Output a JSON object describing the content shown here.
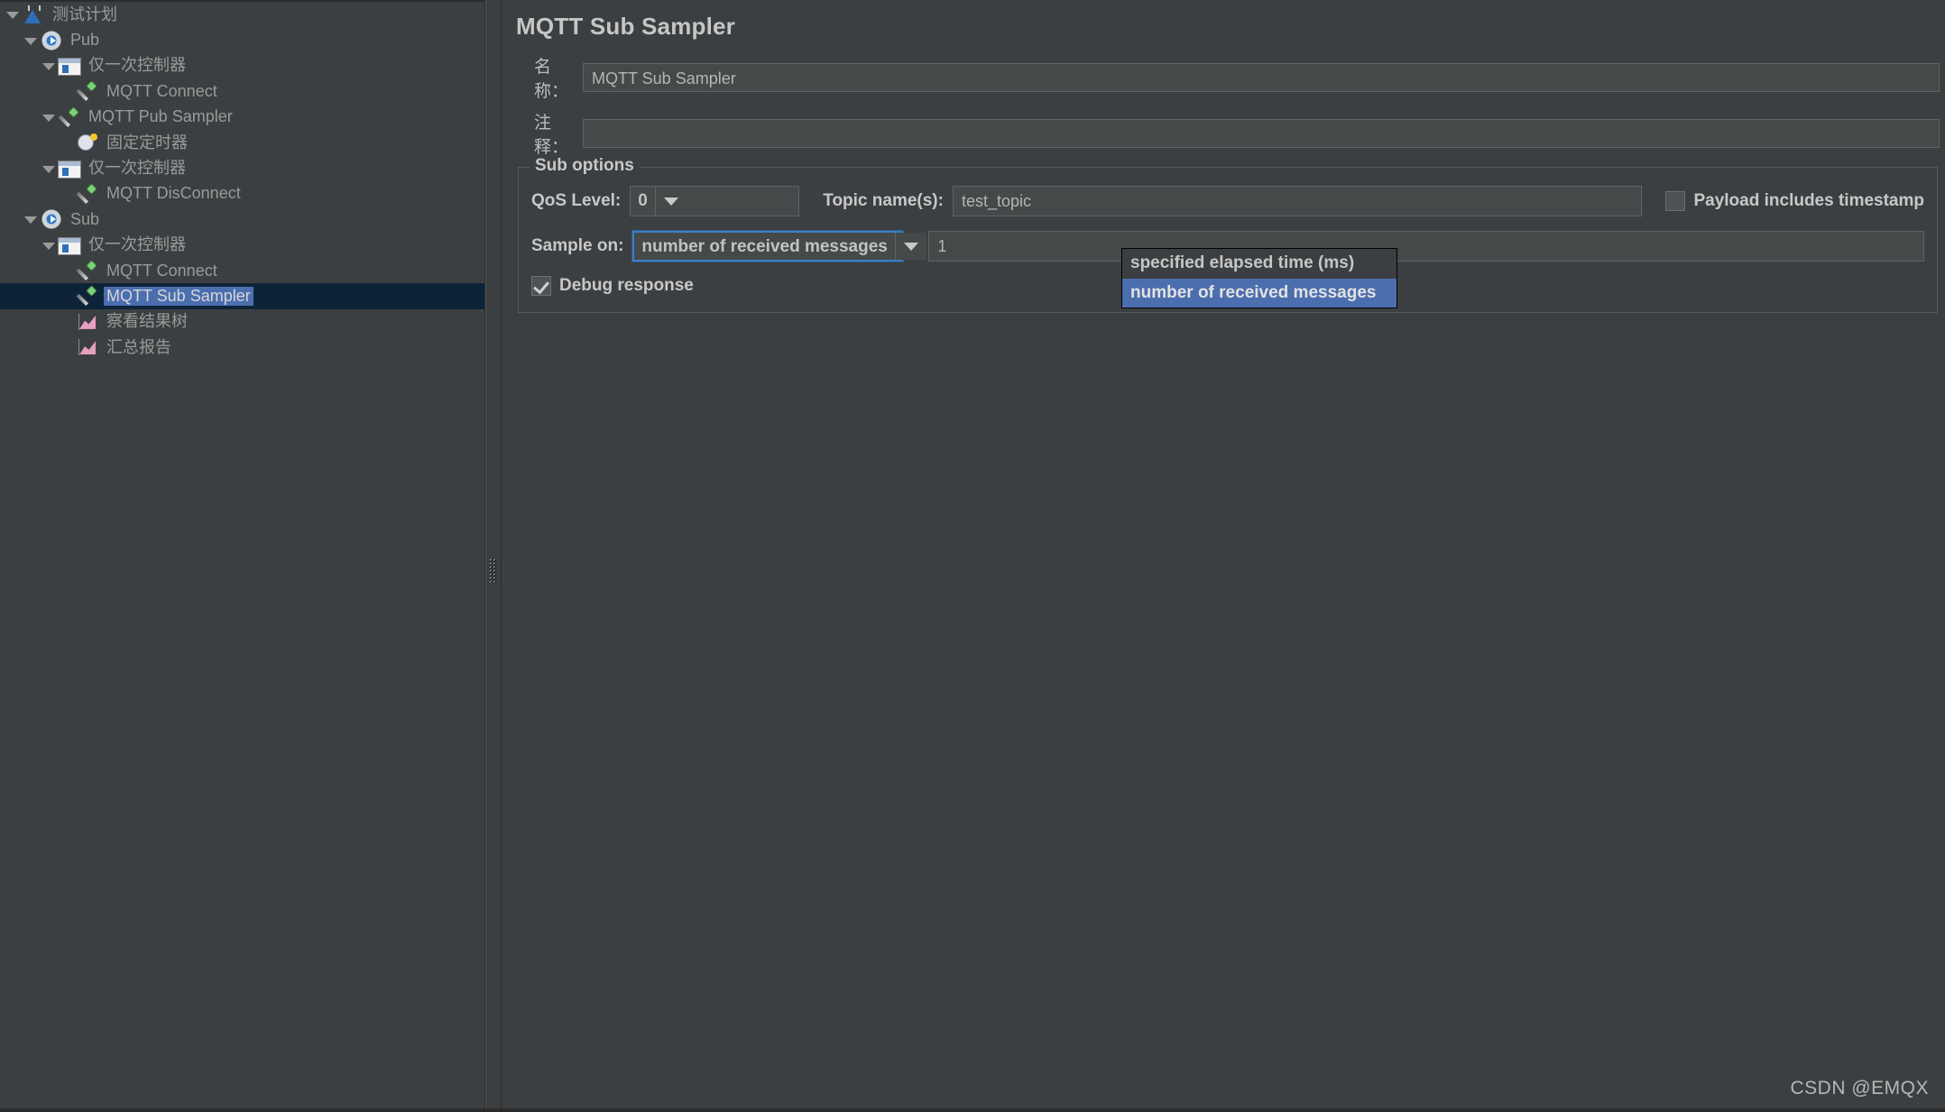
{
  "tree": {
    "items": [
      {
        "label": "测试计划",
        "icon": "flask-icon",
        "indent": 0,
        "twisty": "open",
        "selected": false
      },
      {
        "label": "Pub",
        "icon": "thread-group-gear-icon",
        "indent": 1,
        "twisty": "open",
        "selected": false
      },
      {
        "label": "仅一次控制器",
        "icon": "controller-icon",
        "indent": 2,
        "twisty": "open",
        "selected": false
      },
      {
        "label": "MQTT Connect",
        "icon": "sampler-icon",
        "indent": 3,
        "twisty": "none",
        "selected": false
      },
      {
        "label": "MQTT Pub Sampler",
        "icon": "sampler-icon",
        "indent": 2,
        "twisty": "open",
        "selected": false
      },
      {
        "label": "固定定时器",
        "icon": "timer-icon",
        "indent": 3,
        "twisty": "none",
        "selected": false
      },
      {
        "label": "仅一次控制器",
        "icon": "controller-icon",
        "indent": 2,
        "twisty": "open",
        "selected": false
      },
      {
        "label": "MQTT DisConnect",
        "icon": "sampler-icon",
        "indent": 3,
        "twisty": "none",
        "selected": false
      },
      {
        "label": "Sub",
        "icon": "thread-group-gear-icon",
        "indent": 1,
        "twisty": "open",
        "selected": false
      },
      {
        "label": "仅一次控制器",
        "icon": "controller-icon",
        "indent": 2,
        "twisty": "open",
        "selected": false
      },
      {
        "label": "MQTT Connect",
        "icon": "sampler-icon",
        "indent": 3,
        "twisty": "none",
        "selected": false
      },
      {
        "label": "MQTT Sub Sampler",
        "icon": "sampler-icon",
        "indent": 3,
        "twisty": "none",
        "selected": true
      },
      {
        "label": "察看结果树",
        "icon": "listener-chart-icon",
        "indent": 3,
        "twisty": "none",
        "selected": false
      },
      {
        "label": "汇总报告",
        "icon": "listener-chart-icon",
        "indent": 3,
        "twisty": "none",
        "selected": false
      }
    ]
  },
  "panel": {
    "title": "MQTT Sub Sampler",
    "name_label": "名称：",
    "name_value": "MQTT Sub Sampler",
    "comment_label": "注释：",
    "comment_value": ""
  },
  "sub_options": {
    "group_title": "Sub options",
    "qos_label": "QoS Level:",
    "qos_value": "0",
    "topic_label": "Topic name(s):",
    "topic_value": "test_topic",
    "payload_timestamp_label": "Payload includes timestamp",
    "payload_timestamp_checked": false,
    "sample_on_label": "Sample on:",
    "sample_on_value": "number of received messages",
    "sample_on_count": "1",
    "debug_response_label": "Debug response",
    "debug_response_checked": true,
    "dropdown_open": true,
    "dropdown_options": [
      "specified elapsed time (ms)",
      "number of received messages"
    ],
    "dropdown_selected_index": 1
  },
  "watermark": "CSDN @EMQX",
  "colors": {
    "background": "#3c3f41",
    "field_background": "#45494a",
    "selection_blue": "#4b6eaf",
    "selected_row_bg": "#0d2438",
    "focus_border": "#3d7ec0",
    "text": "#bbbbbb"
  }
}
